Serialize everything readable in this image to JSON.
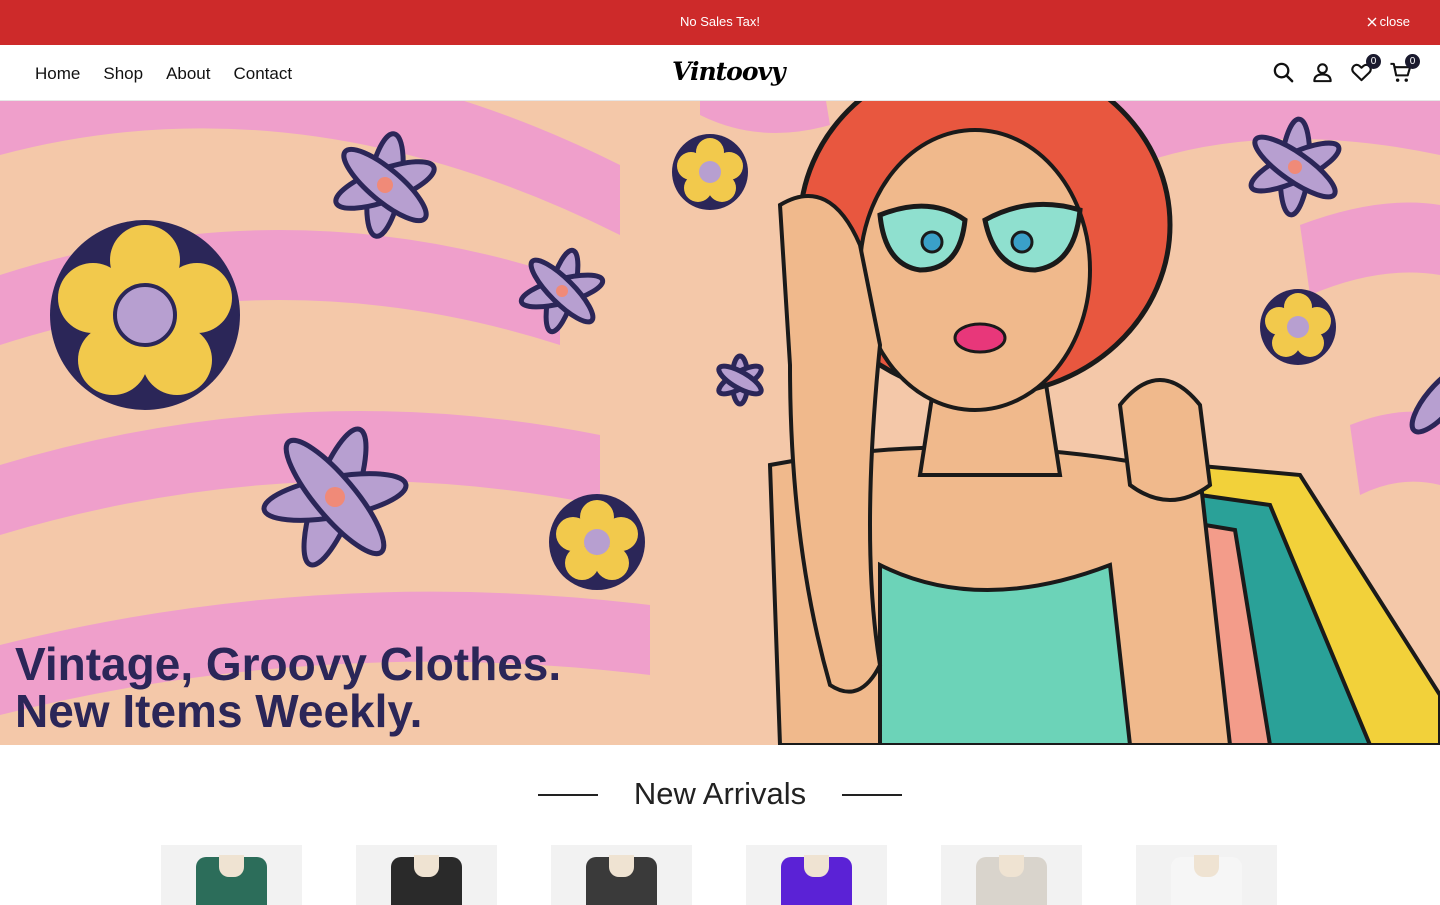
{
  "announcement": {
    "message": "No Sales Tax!",
    "close_label": "close"
  },
  "nav": [
    {
      "label": "Home"
    },
    {
      "label": "Shop"
    },
    {
      "label": "About"
    },
    {
      "label": "Contact"
    }
  ],
  "logo": "Vintoovy",
  "header_icons": {
    "search": "search-icon",
    "account": "user-icon",
    "wishlist": "heart-icon",
    "cart": "cart-icon",
    "wishlist_count": "0",
    "cart_count": "0"
  },
  "hero": {
    "line1": "Vintage, Groovy Clothes.",
    "line2": "New Items Weekly.",
    "text_color": "#2b2658",
    "bg_colors": [
      "#f4c8a9",
      "#ef9fcb"
    ]
  },
  "section": {
    "title": "New Arrivals"
  },
  "products": [
    {
      "color": "#2c6d5a"
    },
    {
      "color": "#2a2a2a"
    },
    {
      "color": "#3a3a3a"
    },
    {
      "color": "#5b22d6"
    },
    {
      "color": "#d9d4cc"
    },
    {
      "color": "#f6f6f6"
    }
  ],
  "colors": {
    "announcement_bg": "#cd2a2a",
    "badge_bg": "#1a1a2e"
  }
}
